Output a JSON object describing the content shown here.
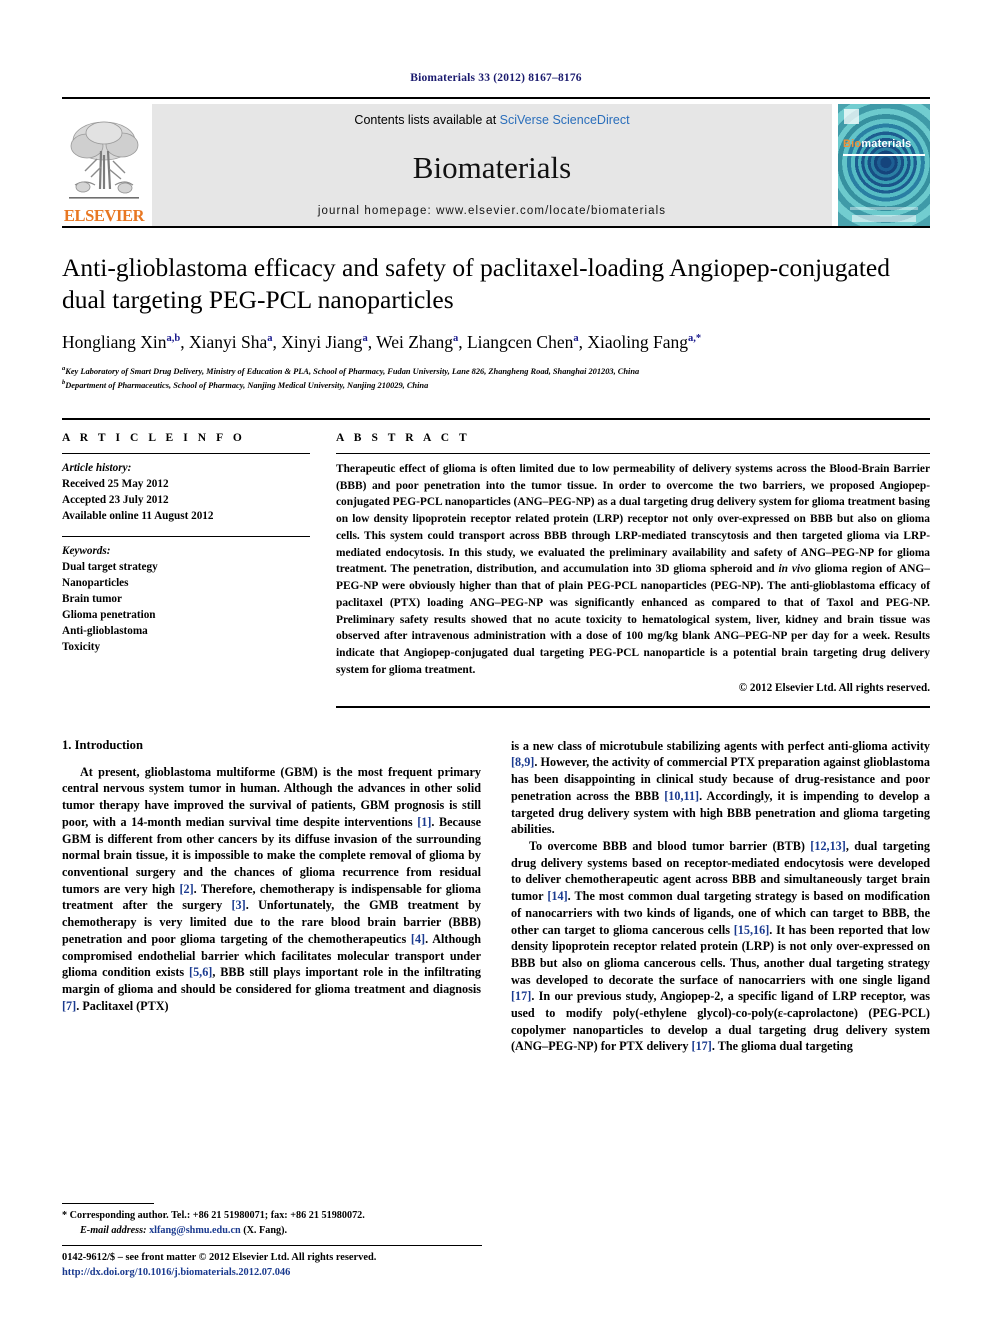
{
  "running_head": "Biomaterials 33 (2012) 8167–8176",
  "masthead": {
    "publisher_name": "ELSEVIER",
    "contents_prefix": "Contents lists available at ",
    "contents_link": "SciVerse ScienceDirect",
    "journal_name": "Biomaterials",
    "homepage": "journal homepage: www.elsevier.com/locate/biomaterials",
    "cover": {
      "title_part1": "Bio",
      "title_part2": "materials"
    }
  },
  "article": {
    "title": "Anti-glioblastoma efficacy and safety of paclitaxel-loading Angiopep-conjugated dual targeting PEG-PCL nanoparticles",
    "authors": [
      {
        "name": "Hongliang Xin",
        "sup": "a,b"
      },
      {
        "name": "Xianyi Sha",
        "sup": "a"
      },
      {
        "name": "Xinyi Jiang",
        "sup": "a"
      },
      {
        "name": "Wei Zhang",
        "sup": "a"
      },
      {
        "name": "Liangcen Chen",
        "sup": "a"
      },
      {
        "name": "Xiaoling Fang",
        "sup": "a,*"
      }
    ],
    "affiliations": [
      {
        "marker": "a",
        "text": "Key Laboratory of Smart Drug Delivery, Ministry of Education & PLA, School of Pharmacy, Fudan University, Lane 826, Zhangheng Road, Shanghai 201203, China"
      },
      {
        "marker": "b",
        "text": "Department of Pharmaceutics, School of Pharmacy, Nanjing Medical University, Nanjing 210029, China"
      }
    ]
  },
  "article_info": {
    "heading": "A R T I C L E   I N F O",
    "history_title": "Article history:",
    "history": [
      "Received 25 May 2012",
      "Accepted 23 July 2012",
      "Available online 11 August 2012"
    ],
    "keywords_title": "Keywords:",
    "keywords": [
      "Dual target strategy",
      "Nanoparticles",
      "Brain tumor",
      "Glioma penetration",
      "Anti-glioblastoma",
      "Toxicity"
    ]
  },
  "abstract": {
    "heading": "A B S T R A C T",
    "part1": "Therapeutic effect of glioma is often limited due to low permeability of delivery systems across the Blood-Brain Barrier (BBB) and poor penetration into the tumor tissue. In order to overcome the two barriers, we proposed Angiopep-conjugated PEG-PCL nanoparticles (ANG–PEG-NP) as a dual targeting drug delivery system for glioma treatment basing on low density lipoprotein receptor related protein (LRP) receptor not only over-expressed on BBB but also on glioma cells. This system could transport across BBB through LRP-mediated transcytosis and then targeted glioma via LRP-mediated endocytosis. In this study, we evaluated the preliminary availability and safety of ANG–PEG-NP for glioma treatment. The penetration, distribution, and accumulation into 3D glioma spheroid and ",
    "italic1": "in vivo",
    "part2": " glioma region of ANG–PEG-NP were obviously higher than that of plain PEG-PCL nanoparticles (PEG-NP). The anti-glioblastoma efficacy of paclitaxel (PTX) loading ANG–PEG-NP was significantly enhanced as compared to that of Taxol and PEG-NP. Preliminary safety results showed that no acute toxicity to hematological system, liver, kidney and brain tissue was observed after intravenous administration with a dose of 100 mg/kg blank ANG–PEG-NP per day for a week. Results indicate that Angiopep-conjugated dual targeting PEG-PCL nanoparticle is a potential brain targeting drug delivery system for glioma treatment.",
    "copyright": "© 2012 Elsevier Ltd. All rights reserved."
  },
  "introduction": {
    "section_number": "1.",
    "section_title": "Introduction",
    "left_para1_a": "At present, glioblastoma multiforme (GBM) is the most frequent primary central nervous system tumor in human. Although the advances in other solid tumor therapy have improved the survival of patients, GBM prognosis is still poor, with a 14-month median survival time despite interventions ",
    "ref1": "[1]",
    "left_para1_b": ". Because GBM is different from other cancers by its diffuse invasion of the surrounding normal brain tissue, it is impossible to make the complete removal of glioma by conventional surgery and the chances of glioma recurrence from residual tumors are very high ",
    "ref2": "[2]",
    "left_para1_c": ". Therefore, chemotherapy is indispensable for glioma treatment after the surgery ",
    "ref3": "[3]",
    "left_para1_d": ". Unfortunately, the GMB treatment by chemotherapy is very limited due to the rare blood brain barrier (BBB) penetration and poor glioma targeting of the chemotherapeutics ",
    "ref4": "[4]",
    "left_para1_e": ". Although compromised endothelial barrier which facilitates molecular transport under glioma condition exists ",
    "ref5": "[5,6]",
    "left_para1_f": ", BBB still plays important role in the infiltrating margin of glioma and should be considered for glioma treatment and diagnosis ",
    "ref7": "[7]",
    "left_para1_g": ". Paclitaxel (PTX)",
    "right_para1_a": "is a new class of microtubule stabilizing agents with perfect anti-glioma activity ",
    "ref89": "[8,9]",
    "right_para1_b": ". However, the activity of commercial PTX preparation against glioblastoma has been disappointing in clinical study because of drug-resistance and poor penetration across the BBB ",
    "ref1011": "[10,11]",
    "right_para1_c": ". Accordingly, it is impending to develop a targeted drug delivery system with high BBB penetration and glioma targeting abilities.",
    "right_para2_a": "To overcome BBB and blood tumor barrier (BTB) ",
    "ref1213": "[12,13]",
    "right_para2_b": ", dual targeting drug delivery systems based on receptor-mediated endocytosis were developed to deliver chemotherapeutic agent across BBB and simultaneously target brain tumor ",
    "ref14": "[14]",
    "right_para2_c": ". The most common dual targeting strategy is based on modification of nanocarriers with two kinds of ligands, one of which can target to BBB, the other can target to glioma cancerous cells ",
    "ref1516": "[15,16]",
    "right_para2_d": ". It has been reported that low density lipoprotein receptor related protein (LRP) is not only over-expressed on BBB but also on glioma cancerous cells. Thus, another dual targeting strategy was developed to decorate the surface of nanocarriers with one single ligand ",
    "ref17a": "[17]",
    "right_para2_e": ". In our previous study, Angiopep-2, a specific ligand of LRP receptor, was used to modify poly(-ethylene glycol)-co-poly(ε-caprolactone) (PEG-PCL) copolymer nanoparticles to develop a dual targeting drug delivery system (ANG–PEG-NP) for PTX delivery ",
    "ref17b": "[17]",
    "right_para2_f": ". The glioma dual targeting"
  },
  "footnotes": {
    "corresponding_marker": "*",
    "corresponding_text": "Corresponding author. Tel.: +86 21 51980071; fax: +86 21 51980072.",
    "email_label": "E-mail address:",
    "email": "xlfang@shmu.edu.cn",
    "email_suffix": "(X. Fang).",
    "issn_line": "0142-9612/$ – see front matter © 2012 Elsevier Ltd. All rights reserved.",
    "doi_line": "http://dx.doi.org/10.1016/j.biomaterials.2012.07.046"
  }
}
